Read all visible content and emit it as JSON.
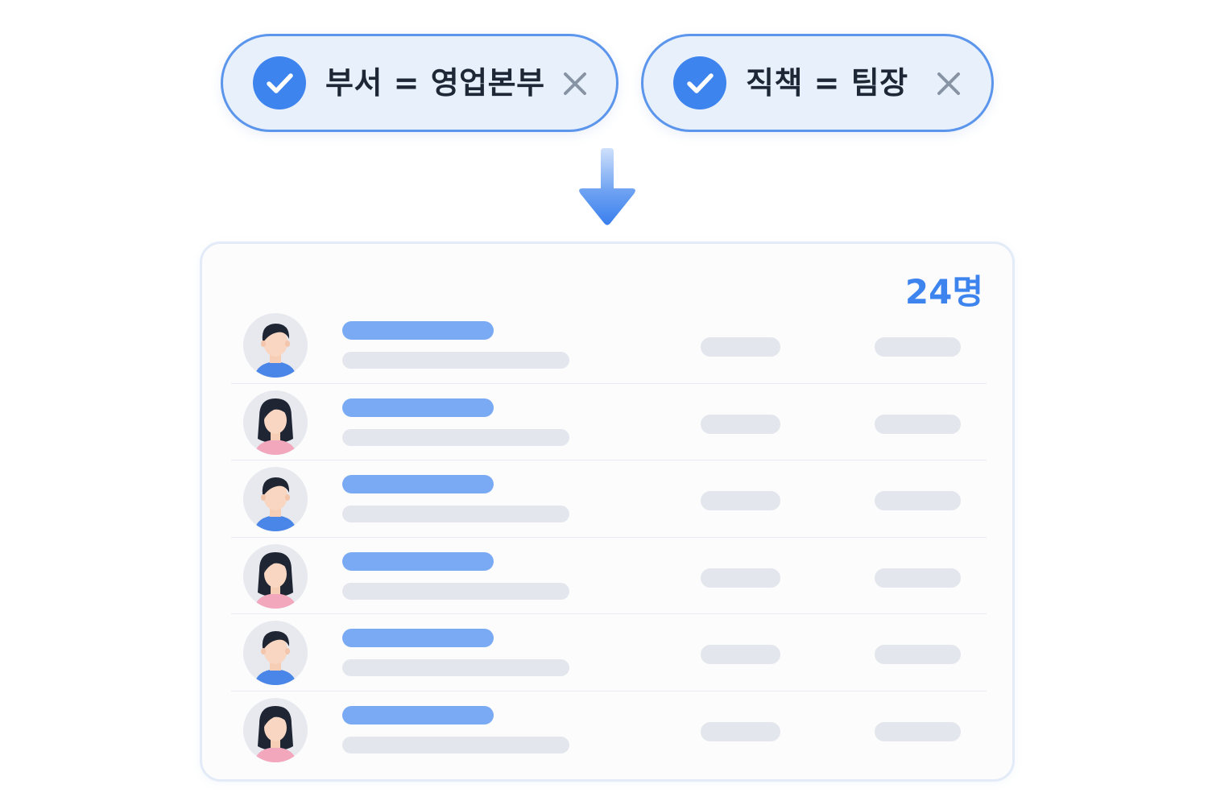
{
  "filters": [
    {
      "label": "부서 = 영업본부",
      "checked": true,
      "check_icon": "check-icon",
      "remove_icon": "close-icon"
    },
    {
      "label": "직책 = 팀장",
      "checked": true,
      "check_icon": "check-icon",
      "remove_icon": "close-icon"
    }
  ],
  "flow_icon": "arrow-down-icon",
  "results": {
    "count_label": "24명",
    "rows": [
      {
        "avatar": "male-avatar-icon"
      },
      {
        "avatar": "female-avatar-icon"
      },
      {
        "avatar": "male-avatar-icon"
      },
      {
        "avatar": "female-avatar-icon"
      },
      {
        "avatar": "male-avatar-icon"
      },
      {
        "avatar": "female-avatar-icon"
      }
    ]
  },
  "colors": {
    "accent": "#3e84ee",
    "chip_bg": "#e8f0fc",
    "chip_border": "#5b95ec",
    "name_placeholder": "#7aaaf4",
    "text_placeholder": "#e3e6ec",
    "male_shirt": "#4a86e8",
    "female_shirt": "#f2a7bd"
  }
}
